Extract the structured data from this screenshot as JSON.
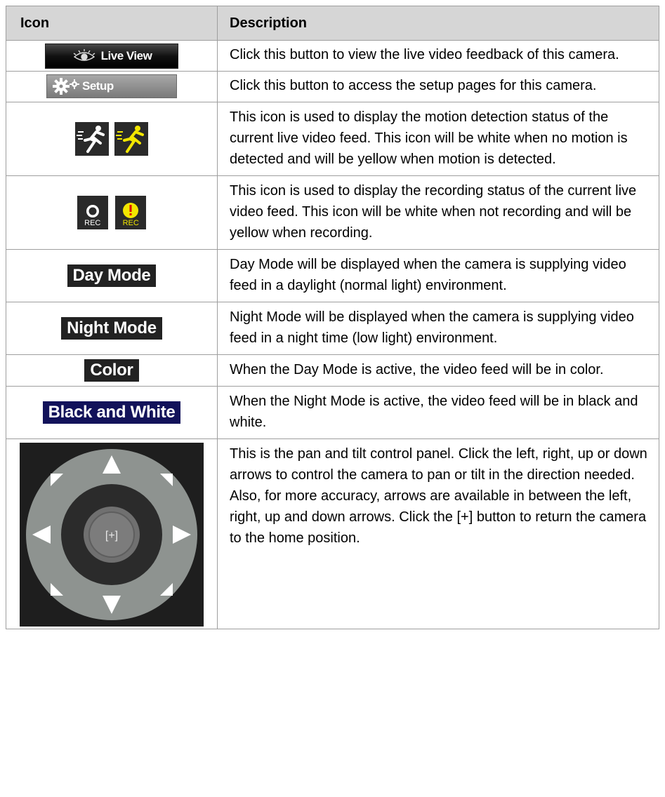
{
  "header": {
    "icon": "Icon",
    "description": "Description"
  },
  "rows": [
    {
      "icon_text": "Live View",
      "description": "Click this button to view the live video feedback of this camera."
    },
    {
      "icon_text": "Setup",
      "description": "Click this button to access the setup pages for this camera."
    },
    {
      "description": "This icon is used to display the motion detection status of the current live video feed. This icon will be white when no motion is detected and will be yellow when motion is detected."
    },
    {
      "icon_text": "REC",
      "icon_text_2": "REC",
      "description": "This icon is used to display the recording status of the current live video feed. This icon will be white when not recording and will be yellow when recording."
    },
    {
      "icon_text": "Day Mode",
      "description": "Day Mode will be displayed when the camera is supplying video feed in a daylight (normal light) environment."
    },
    {
      "icon_text": "Night Mode",
      "description": "Night Mode will be displayed when the camera is supplying video feed in a night time (low light) environment."
    },
    {
      "icon_text": "Color",
      "description": "When the Day Mode is active, the video feed will be in color."
    },
    {
      "icon_text": "Black and White",
      "description": "When the Night Mode is active, the video feed will be in black and white."
    },
    {
      "icon_text": "[+]",
      "description": "This is the pan and tilt control panel. Click the left, right, up or down arrows to control the camera to pan or tilt in the direction needed. Also, for more accuracy, arrows are available in between the left, right, up and down arrows. Click the [+] button to return the camera to the home position."
    }
  ],
  "colors": {
    "header_bg": "#d6d6d6",
    "active_yellow": "#f2e600",
    "icon_bg": "#2a2a2a"
  },
  "icons": [
    "eye-icon",
    "gear-icon",
    "running-man-icon",
    "record-icon",
    "alert-icon",
    "pan-tilt-control-icon"
  ]
}
